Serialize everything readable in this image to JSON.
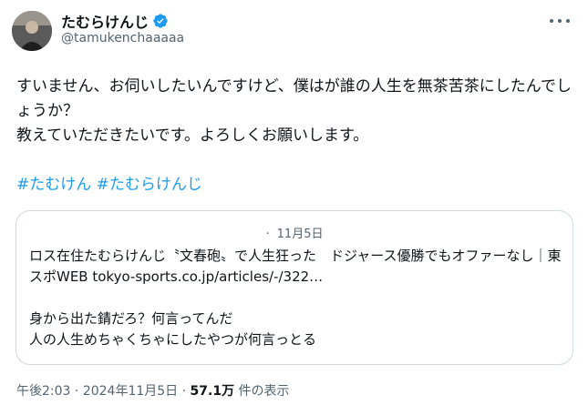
{
  "author": {
    "display_name": "たむらけんじ",
    "handle": "@tamukenchaaaaa"
  },
  "tweet": {
    "text": "すいません、お伺いしたいんですけど、僕はが誰の人生を無茶苦茶にしたんでしょうか？\n教えていただきたいです。よろしくお願いします。",
    "hashtags": [
      "#たむけん",
      "#たむらけんじ"
    ]
  },
  "card": {
    "date": "11月5日",
    "text": "ロス在住たむらけんじ〝文春砲〟で人生狂った　ドジャース優勝でもオファーなし｜東スポWEB tokyo-sports.co.jp/articles/-/322…\n\n身から出た錆だろ？何言ってんだ\n人の人生めちゃくちゃにしたやつが何言っとる"
  },
  "meta": {
    "time": "午後2:03",
    "separator1": " · ",
    "date": "2024年11月5日",
    "separator2": " · ",
    "views": "57.1万",
    "views_label": " 件の表示"
  },
  "icons": {
    "verified": "verified-badge-icon",
    "more": "more-options-icon"
  },
  "colors": {
    "accent": "#1d9bf0",
    "text": "#0f1419",
    "muted": "#536471",
    "border": "#cfd9de"
  }
}
